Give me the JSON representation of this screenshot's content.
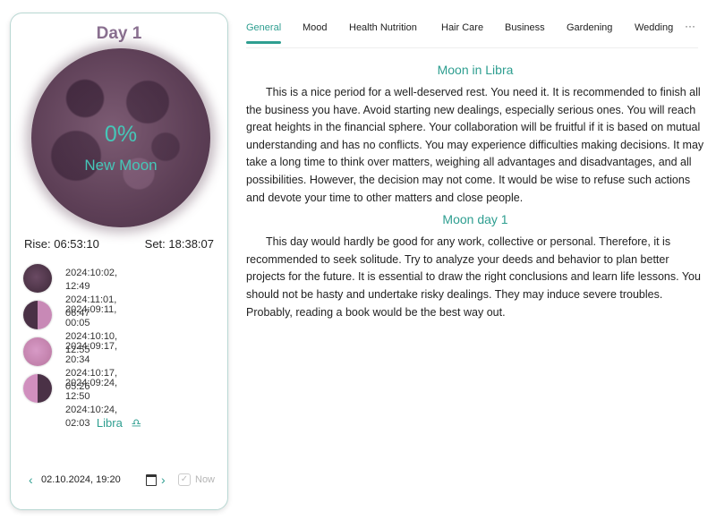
{
  "moon_panel": {
    "day_title": "Day 1",
    "illumination": "0%",
    "phase_name": "New Moon",
    "rise": "Rise: 06:53:10",
    "set": "Set: 18:38:07",
    "phases": [
      {
        "icon": "new-moon-icon",
        "line1": "2024:10:02, 12:49",
        "line2": "2024:11:01, 06:47"
      },
      {
        "icon": "first-quarter-icon",
        "line1": "2024:09:11, 00:05",
        "line2": "2024:10:10, 12:55"
      },
      {
        "icon": "full-moon-icon",
        "line1": "2024:09:17, 20:34",
        "line2": "2024:10:17, 05:26"
      },
      {
        "icon": "last-quarter-icon",
        "line1": "2024:09:24, 12:50",
        "line2": "2024:10:24, 02:03"
      }
    ],
    "zodiac": "Libra",
    "zodiac_glyph": "♎",
    "footer": {
      "prev": "‹",
      "date": "02.10.2024, 19:20",
      "next": "›",
      "check": "✓",
      "now_label": "Now"
    }
  },
  "tabs": [
    "General",
    "Mood",
    "Health Nutrition",
    "Hair Care",
    "Business",
    "Gardening",
    "Wedding"
  ],
  "tabs_more": "···",
  "content": {
    "section1_title": "Moon in Libra",
    "section1_text": "This is a nice period for a well-deserved rest. You need it. It is recommended to finish all the business you have. Avoid starting new dealings, especially serious ones. You will reach great heights in the financial sphere. Your collaboration will be fruitful if it is based on mutual understanding and has no conflicts. You may experience difficulties making decisions. It may take a long time to think over matters, weighing all advantages and disadvantages, and all possibilities. However, the decision may not come. It would be wise to refuse such actions and devote your time to other matters and close people.",
    "section2_title": "Moon day 1",
    "section2_text": "This day would hardly be good for any work, collective or personal. Therefore, it is recommended to seek solitude. Try to analyze your deeds and behavior to plan better projects for the future. It is essential to draw the right conclusions and learn life lessons. You should not be hasty and undertake risky dealings. They may induce severe troubles. Probably, reading a book would be the best way out."
  },
  "colors": {
    "accent": "#2e9e90",
    "moon_text": "#45c7b8",
    "title": "#8a7090"
  }
}
